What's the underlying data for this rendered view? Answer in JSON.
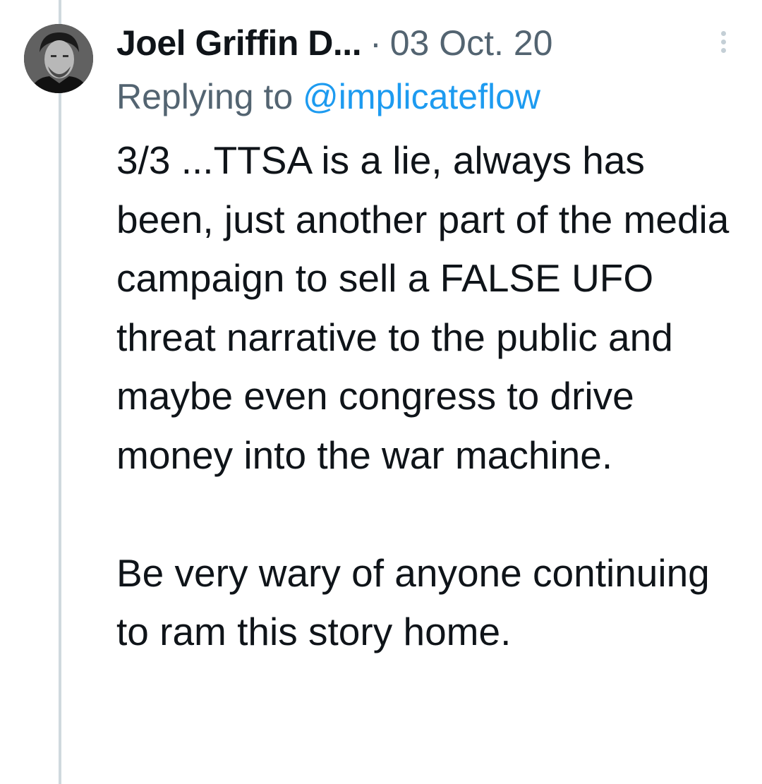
{
  "author": {
    "display_name": "Joel Griffin D...",
    "avatar_icon": "profile-photo"
  },
  "separator": "·",
  "date": "03 Oct. 20",
  "reply": {
    "prefix": "Replying to ",
    "handle": "@implicateflow"
  },
  "tweet_text": "3/3 ...TTSA is a lie, always has been, just another part of the media campaign to sell a FALSE UFO threat narrative to the public and maybe even congress to drive money into the war machine.\n\nBe very wary of anyone continuing to ram this story home.",
  "colors": {
    "text_primary": "#0f1419",
    "text_secondary": "#536471",
    "link": "#1d9bf0",
    "thread_line": "#cfd9de"
  }
}
